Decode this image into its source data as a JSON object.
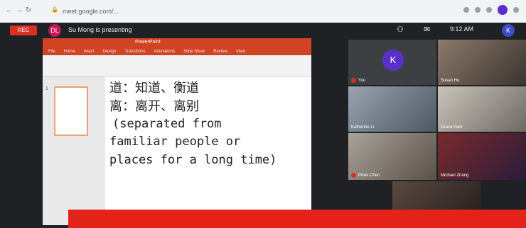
{
  "browser": {
    "back": "←",
    "forward": "→",
    "reload": "↻",
    "url": "meet.google.com/..."
  },
  "meet": {
    "record": "REC",
    "presenter_initials": "DL",
    "presenting": "Su Mong is presenting",
    "time": "9:12 AM",
    "user_initial": "K"
  },
  "slide": {
    "app_title": "PowerPoint",
    "tabs": [
      "File",
      "Home",
      "Insert",
      "Design",
      "Transitions",
      "Animations",
      "Slide Show",
      "Review",
      "View"
    ],
    "thumb_num": "1",
    "lines": [
      "道：知道、衡道",
      "离：离开、离别",
      "(separated from",
      "familiar people or",
      "places for a long time)"
    ]
  },
  "participants": [
    {
      "name": "You",
      "initial": "K"
    },
    {
      "name": "Susan Hu"
    },
    {
      "name": "Katherine Li"
    },
    {
      "name": "Grace Park"
    },
    {
      "name": "Peter Chen"
    },
    {
      "name": "Michael Zhang"
    }
  ],
  "colors": {
    "record": "#d93025",
    "banner": "#e3231a",
    "ppt": "#d04423"
  }
}
